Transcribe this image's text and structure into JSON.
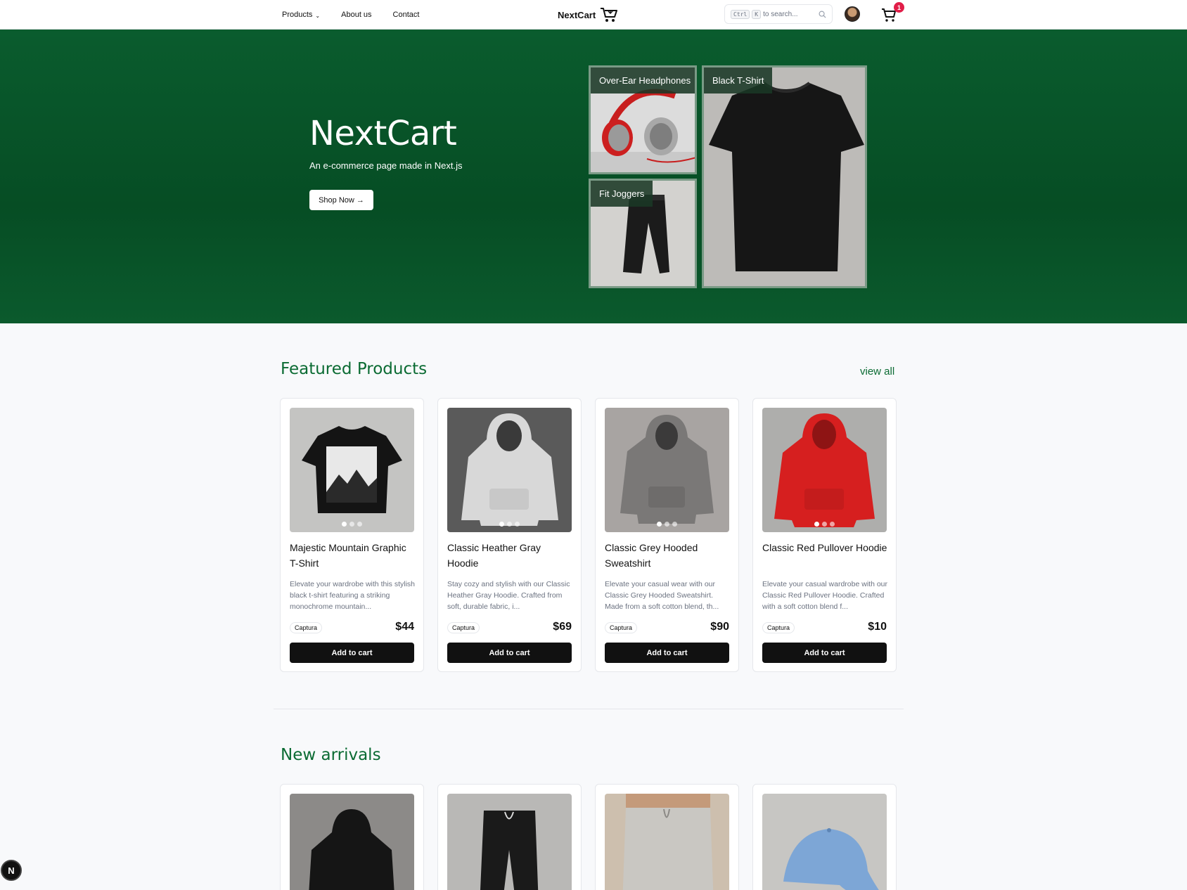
{
  "header": {
    "nav": [
      {
        "label": "Products",
        "has_chevron": true
      },
      {
        "label": "About us"
      },
      {
        "label": "Contact"
      }
    ],
    "brand": "NextCart",
    "search": {
      "kbd1": "Ctrl",
      "kbd2": "K",
      "placeholder": "to search..."
    },
    "cart_count": "1"
  },
  "hero": {
    "title": "NextCart",
    "subtitle": "An e-commerce page made in Next.js",
    "cta": "Shop Now →",
    "tiles": [
      {
        "label": "Over-Ear Headphones"
      },
      {
        "label": "Black T-Shirt"
      },
      {
        "label": "Fit Joggers"
      }
    ]
  },
  "featured": {
    "title": "Featured Products",
    "view_all": "view all",
    "products": [
      {
        "name": "Majestic Mountain Graphic T-Shirt",
        "desc": "Elevate your wardrobe with this stylish black t-shirt featuring a striking monochrome mountain...",
        "brand": "Captura",
        "price": "$44",
        "cta": "Add to cart"
      },
      {
        "name": "Classic Heather Gray Hoodie",
        "desc": "Stay cozy and stylish with our Classic Heather Gray Hoodie. Crafted from soft, durable fabric, i...",
        "brand": "Captura",
        "price": "$69",
        "cta": "Add to cart"
      },
      {
        "name": "Classic Grey Hooded Sweatshirt",
        "desc": "Elevate your casual wear with our Classic Grey Hooded Sweatshirt. Made from a soft cotton blend, th...",
        "brand": "Captura",
        "price": "$90",
        "cta": "Add to cart"
      },
      {
        "name": "Classic Red Pullover Hoodie",
        "desc": "Elevate your casual wardrobe with our Classic Red Pullover Hoodie. Crafted with a soft cotton blend f...",
        "brand": "Captura",
        "price": "$10",
        "cta": "Add to cart"
      }
    ]
  },
  "new_arrivals": {
    "title": "New arrivals"
  },
  "colors": {
    "accent": "#0b6b33",
    "hero_bg": "#075428",
    "button": "#111111",
    "badge": "#e11d48"
  },
  "dev_badge": "N"
}
